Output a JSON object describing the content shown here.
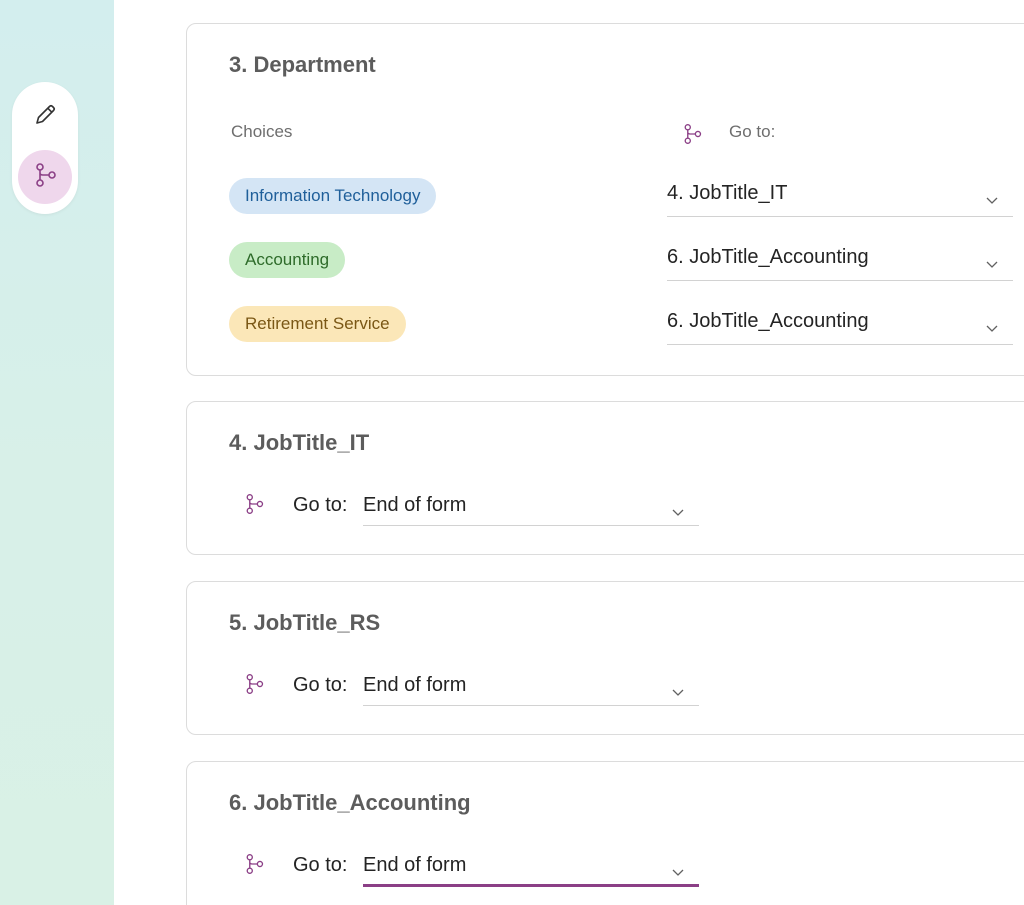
{
  "sidebar": {
    "tools": [
      {
        "icon": "pencil-icon"
      },
      {
        "icon": "branch-icon",
        "active": true
      }
    ]
  },
  "accent_color": "#8b3f86",
  "questions": [
    {
      "title": "3. Department",
      "choices_header": "Choices",
      "goto_header": "Go to:",
      "choices": [
        {
          "label": "Information Technology",
          "color": "blue",
          "goto": "4. JobTitle_IT"
        },
        {
          "label": "Accounting",
          "color": "green",
          "goto": "6. JobTitle_Accounting"
        },
        {
          "label": "Retirement Service",
          "color": "yellow",
          "goto": "6. JobTitle_Accounting"
        }
      ]
    },
    {
      "title": "4. JobTitle_IT",
      "goto_label": "Go to:",
      "goto_value": "End of form"
    },
    {
      "title": "5. JobTitle_RS",
      "goto_label": "Go to:",
      "goto_value": "End of form"
    },
    {
      "title": "6. JobTitle_Accounting",
      "goto_label": "Go to:",
      "goto_value": "End of form"
    }
  ]
}
